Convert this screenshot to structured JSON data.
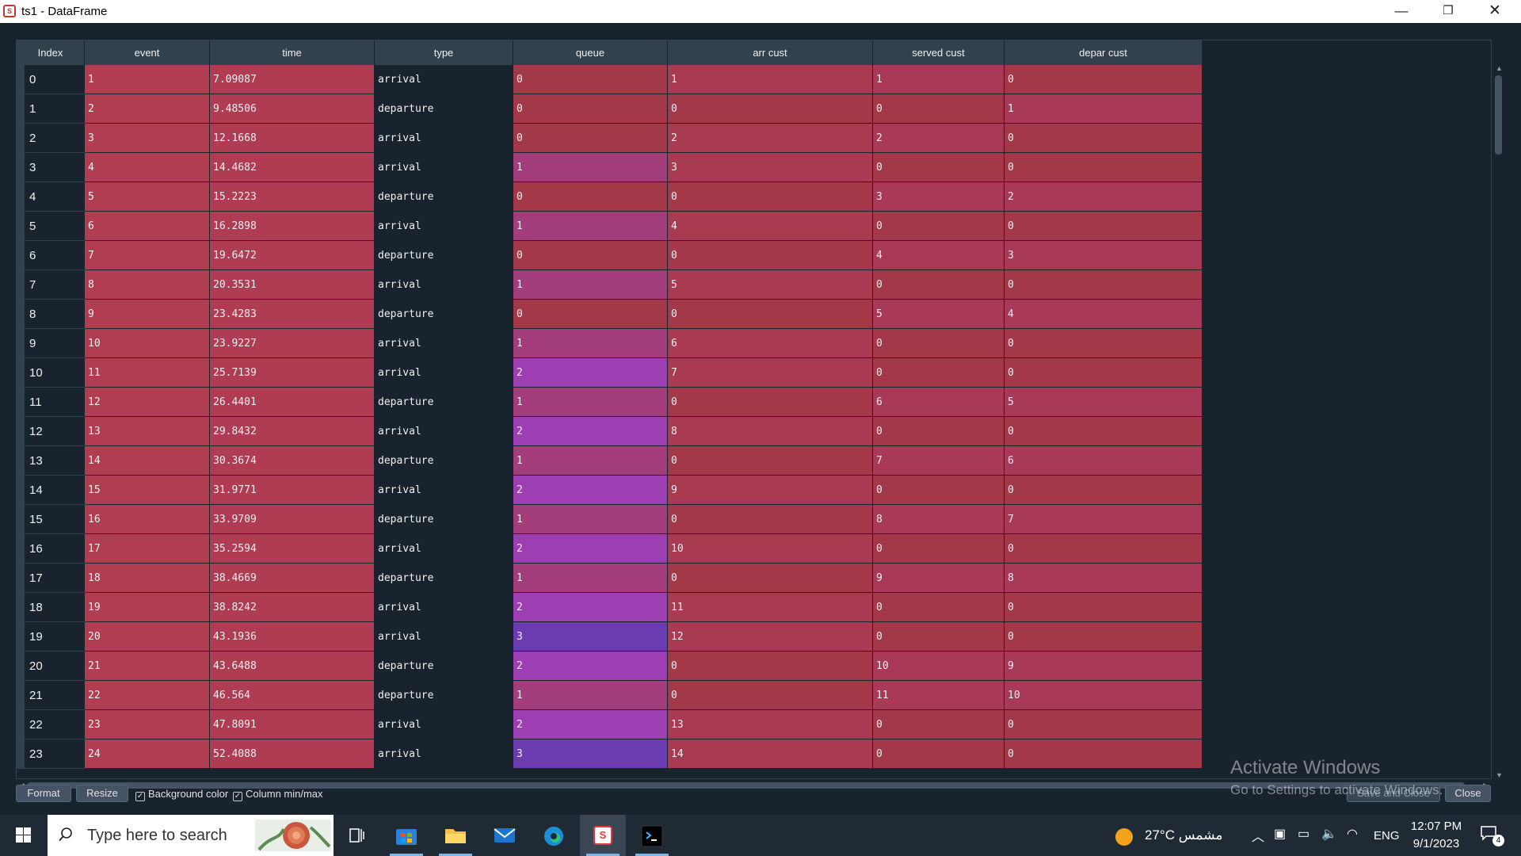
{
  "window": {
    "title": "ts1 - DataFrame",
    "app_icon": "spyder-icon",
    "controls": {
      "minimize": "—",
      "maximize": "❐",
      "close": "✕"
    }
  },
  "table": {
    "columns": [
      "Index",
      "event",
      "time",
      "type",
      "queue",
      "arr cust",
      "served cust",
      "depar cust"
    ],
    "rows": [
      [
        "0",
        "1",
        "7.09087",
        "arrival",
        "0",
        "1",
        "1",
        "0"
      ],
      [
        "1",
        "2",
        "9.48506",
        "departure",
        "0",
        "0",
        "0",
        "1"
      ],
      [
        "2",
        "3",
        "12.1668",
        "arrival",
        "0",
        "2",
        "2",
        "0"
      ],
      [
        "3",
        "4",
        "14.4682",
        "arrival",
        "1",
        "3",
        "0",
        "0"
      ],
      [
        "4",
        "5",
        "15.2223",
        "departure",
        "0",
        "0",
        "3",
        "2"
      ],
      [
        "5",
        "6",
        "16.2898",
        "arrival",
        "1",
        "4",
        "0",
        "0"
      ],
      [
        "6",
        "7",
        "19.6472",
        "departure",
        "0",
        "0",
        "4",
        "3"
      ],
      [
        "7",
        "8",
        "20.3531",
        "arrival",
        "1",
        "5",
        "0",
        "0"
      ],
      [
        "8",
        "9",
        "23.4283",
        "departure",
        "0",
        "0",
        "5",
        "4"
      ],
      [
        "9",
        "10",
        "23.9227",
        "arrival",
        "1",
        "6",
        "0",
        "0"
      ],
      [
        "10",
        "11",
        "25.7139",
        "arrival",
        "2",
        "7",
        "0",
        "0"
      ],
      [
        "11",
        "12",
        "26.4401",
        "departure",
        "1",
        "0",
        "6",
        "5"
      ],
      [
        "12",
        "13",
        "29.8432",
        "arrival",
        "2",
        "8",
        "0",
        "0"
      ],
      [
        "13",
        "14",
        "30.3674",
        "departure",
        "1",
        "0",
        "7",
        "6"
      ],
      [
        "14",
        "15",
        "31.9771",
        "arrival",
        "2",
        "9",
        "0",
        "0"
      ],
      [
        "15",
        "16",
        "33.9709",
        "departure",
        "1",
        "0",
        "8",
        "7"
      ],
      [
        "16",
        "17",
        "35.2594",
        "arrival",
        "2",
        "10",
        "0",
        "0"
      ],
      [
        "17",
        "18",
        "38.4669",
        "departure",
        "1",
        "0",
        "9",
        "8"
      ],
      [
        "18",
        "19",
        "38.8242",
        "arrival",
        "2",
        "11",
        "0",
        "0"
      ],
      [
        "19",
        "20",
        "43.1936",
        "arrival",
        "3",
        "12",
        "0",
        "0"
      ],
      [
        "20",
        "21",
        "43.6488",
        "departure",
        "2",
        "0",
        "10",
        "9"
      ],
      [
        "21",
        "22",
        "46.564",
        "departure",
        "1",
        "0",
        "11",
        "10"
      ],
      [
        "22",
        "23",
        "47.8091",
        "arrival",
        "2",
        "13",
        "0",
        "0"
      ],
      [
        "23",
        "24",
        "52.4088",
        "arrival",
        "3",
        "14",
        "0",
        "0"
      ]
    ],
    "colors": {
      "text_column_bg": "#19232d",
      "header_bg": "#32414b",
      "queue_0": "#a23848",
      "queue_1": "#a43d7c",
      "queue_2": "#9d3eb2",
      "queue_3": "#6a3cb0",
      "event_col": "#b03d52",
      "time_col": "#af3c52",
      "arr_zero": "#a23848",
      "arr_nonzero": "#a83a52",
      "served_zero": "#a23848",
      "served_nonzero": "#a83a58",
      "depar_zero": "#a23848",
      "depar_nonzero": "#a83a58"
    }
  },
  "controls": {
    "format_label": "Format",
    "resize_label": "Resize",
    "background_color_label": "Background color",
    "background_color_checked": true,
    "column_minmax_label": "Column min/max",
    "column_minmax_checked": true,
    "save_close_label": "Save and Close",
    "close_label": "Close"
  },
  "watermark": {
    "title": "Activate Windows",
    "subtitle": "Go to Settings to activate Windows."
  },
  "taskbar": {
    "search_placeholder": "Type here to search",
    "apps": [
      "task-view-icon",
      "microsoft-store-icon",
      "file-explorer-icon",
      "mail-icon",
      "edge-icon",
      "spyder-icon",
      "terminal-icon"
    ],
    "active_app": "spyder-icon",
    "weather": "27°C  مشمس",
    "language": "ENG",
    "time": "12:07 PM",
    "date": "9/1/2023",
    "notification_count": "4"
  }
}
